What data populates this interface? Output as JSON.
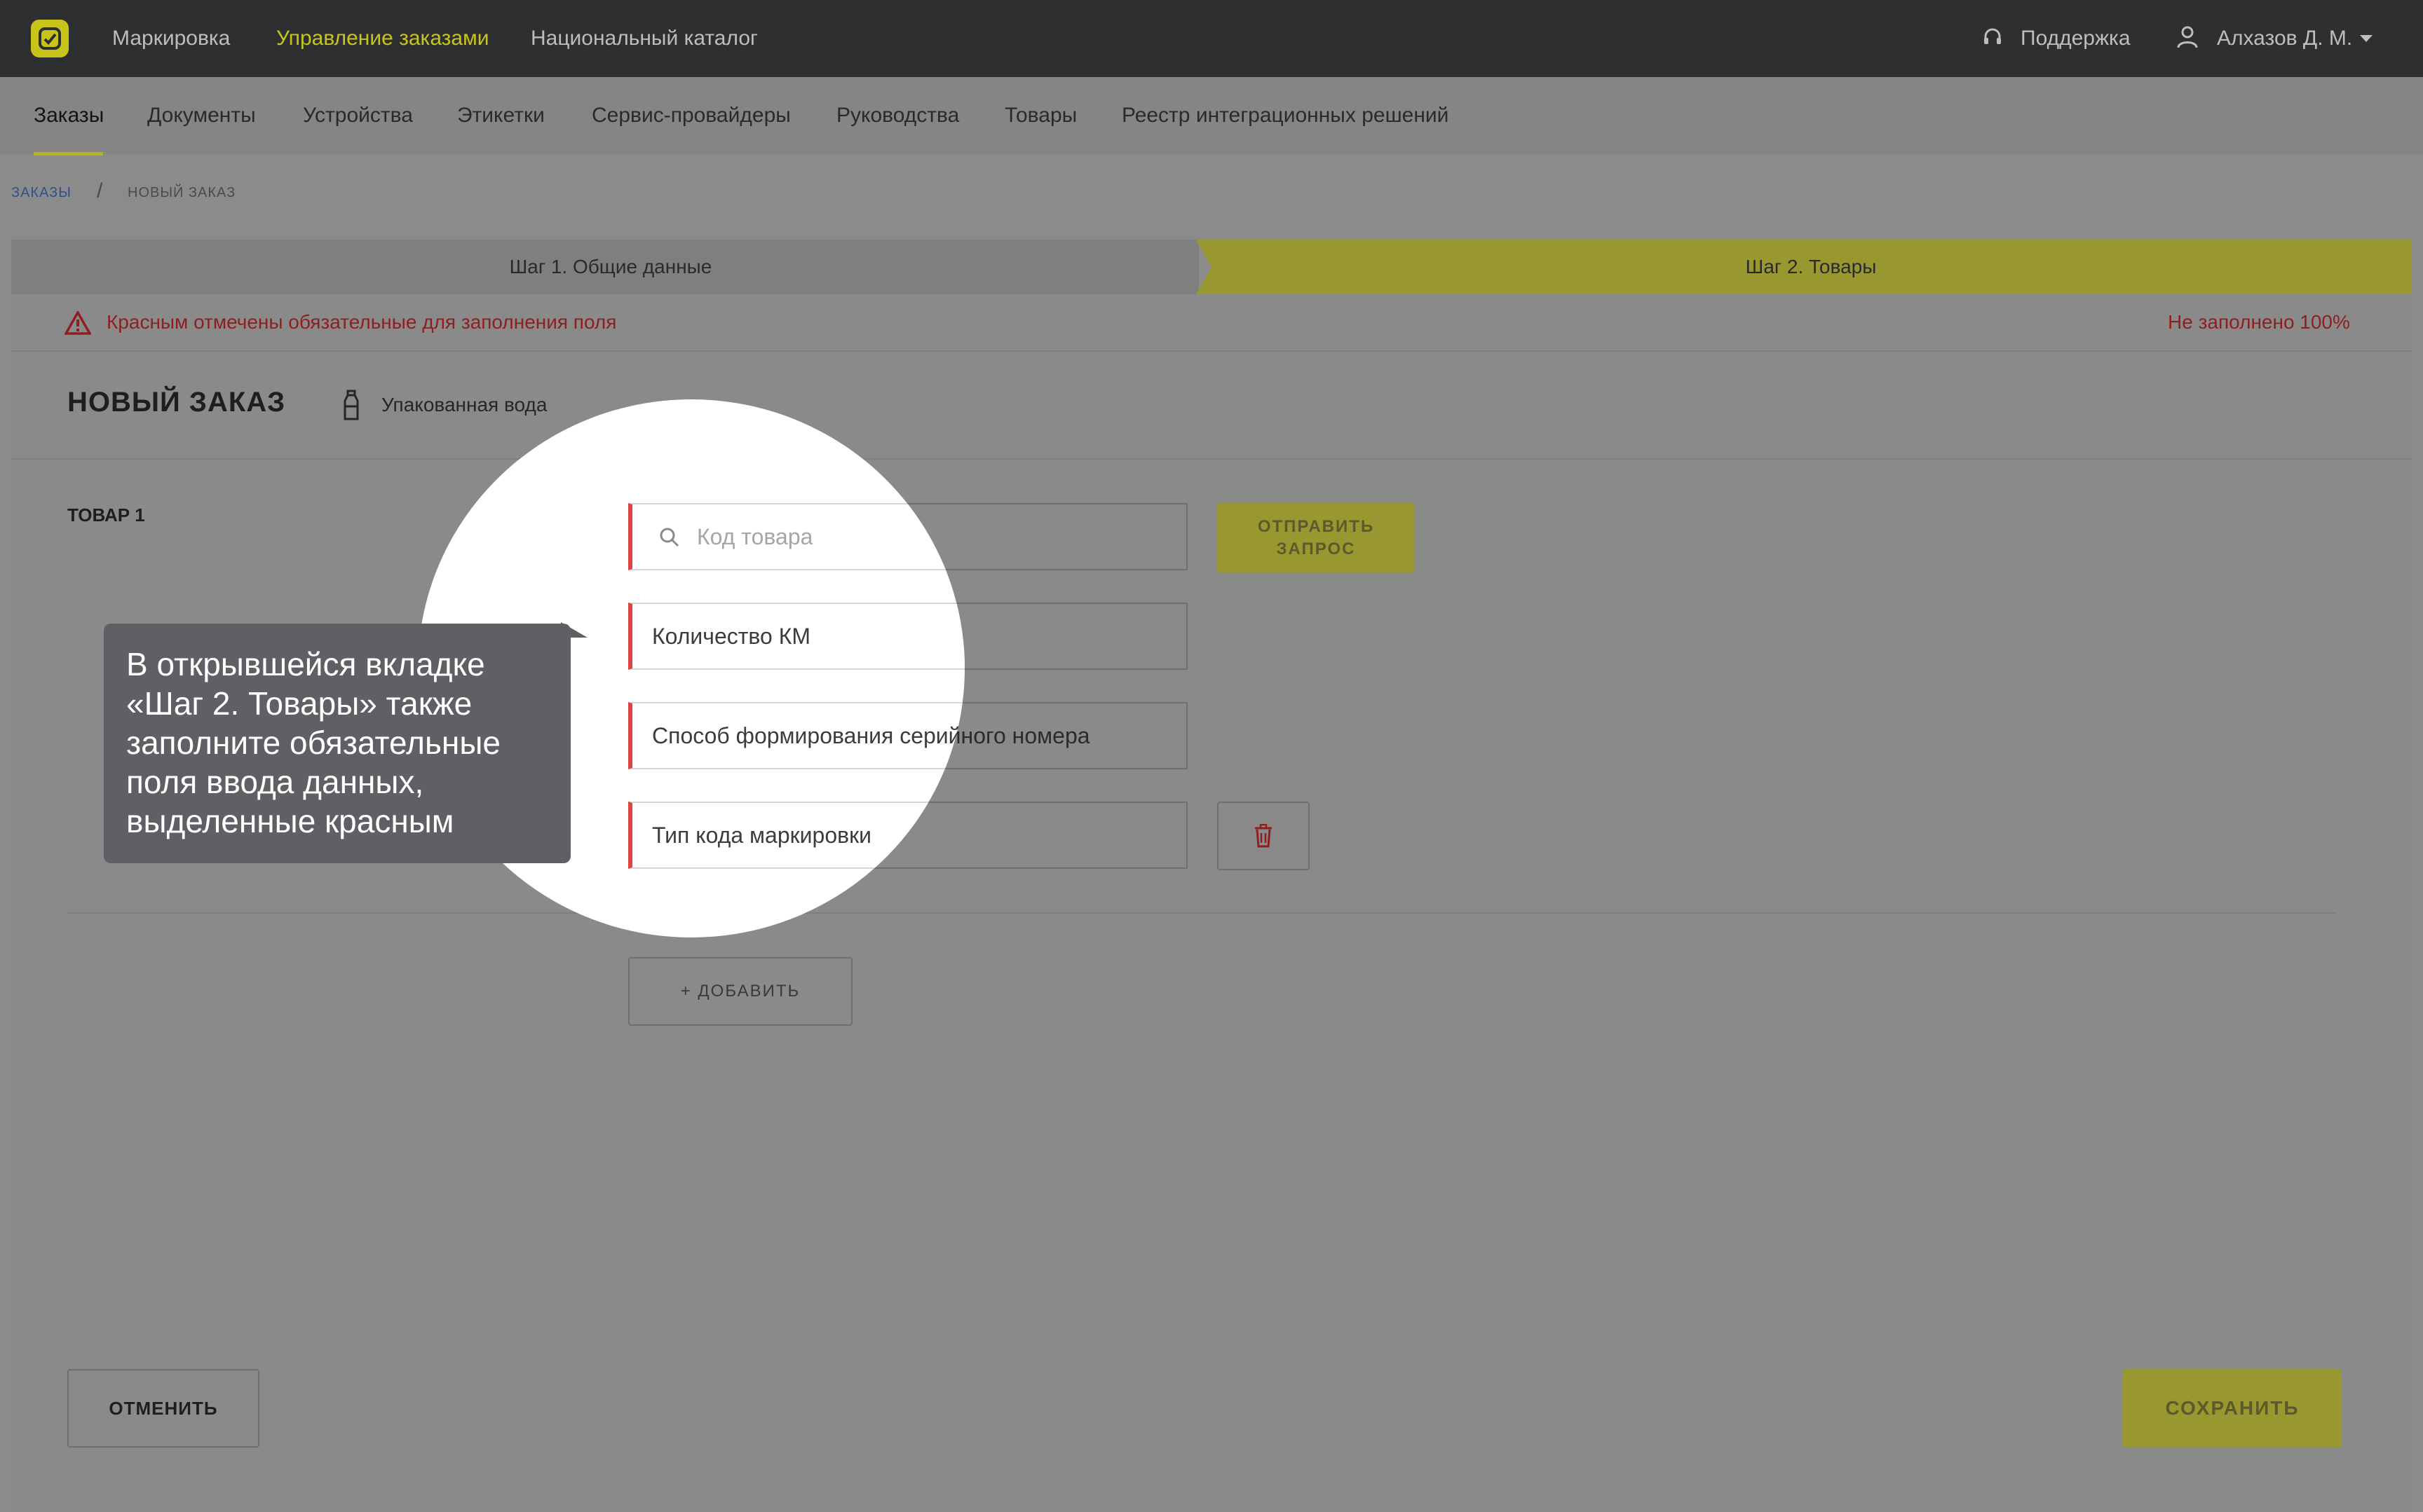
{
  "topbar": {
    "nav": [
      "Маркировка",
      "Управление заказами",
      "Национальный каталог"
    ],
    "support": "Поддержка",
    "user": "Алхазов Д. М."
  },
  "subnav": {
    "tabs": [
      "Заказы",
      "Документы",
      "Устройства",
      "Этикетки",
      "Сервис-провайдеры",
      "Руководства",
      "Товары",
      "Реестр интеграционных решений"
    ]
  },
  "breadcrumb": {
    "root": "ЗАКАЗЫ",
    "separator": "/",
    "current": "НОВЫЙ ЗАКАЗ"
  },
  "steps": {
    "step1": "Шаг 1. Общие данные",
    "step2": "Шаг 2. Товары"
  },
  "warning": {
    "text": "Красным отмечены обязательные для заполнения поля",
    "progress": "Не заполнено 100%"
  },
  "order": {
    "title": "НОВЫЙ ЗАКАЗ",
    "category": "Упакованная вода",
    "item_label": "ТОВАР 1",
    "fields": {
      "product_code_placeholder": "Код товара",
      "km_quantity": "Количество КМ",
      "serial_method": "Способ формирования серийного номера",
      "code_type": "Тип кода маркировки"
    },
    "send_request": "ОТПРАВИТЬ ЗАПРОС",
    "add": "+ ДОБАВИТЬ",
    "cancel": "ОТМЕНИТЬ",
    "save": "СОХРАНИТЬ"
  },
  "tooltip": {
    "text": "В открывшейся вкладке «Шаг 2. Товары» также заполните обязательные поля ввода данных, выделенные красным"
  },
  "colors": {
    "accent": "#c9c41a",
    "required": "#e04545",
    "topbar": "#2e2f31",
    "tooltip": "#5e6063"
  }
}
